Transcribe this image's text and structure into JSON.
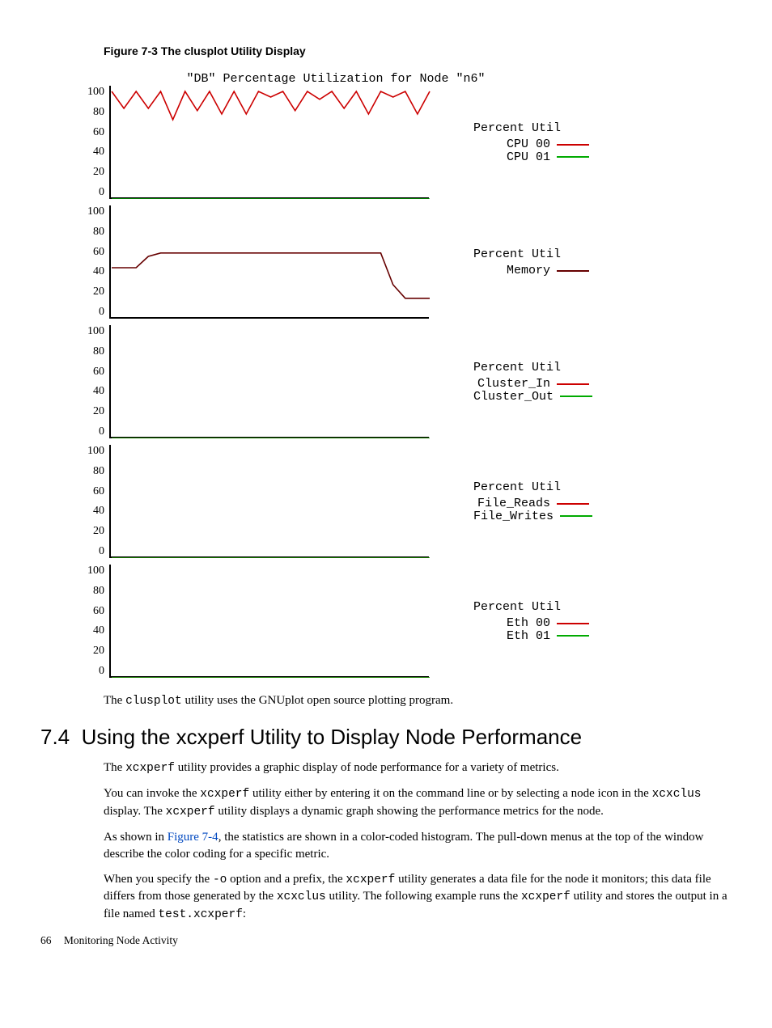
{
  "figure": {
    "caption": "Figure 7-3  The clusplot Utility Display",
    "title": "\"DB\" Percentage Utilization for Node \"n6\""
  },
  "yticks": [
    "100",
    "80",
    "60",
    "40",
    "20",
    "0"
  ],
  "chart_data": [
    {
      "type": "line",
      "title": "Percent Util",
      "ylabel": "",
      "xlabel": "",
      "ylim": [
        0,
        100
      ],
      "series": [
        {
          "name": "CPU 00",
          "color": "#c00",
          "values": [
            95,
            80,
            95,
            80,
            95,
            70,
            95,
            78,
            95,
            75,
            95,
            75,
            95,
            90,
            95,
            78,
            95,
            88,
            95,
            80,
            95,
            75,
            95,
            90,
            95,
            75,
            95
          ]
        },
        {
          "name": "CPU 01",
          "color": "#0a0",
          "values": [
            0,
            0,
            0,
            0,
            0,
            0,
            0,
            0,
            0,
            0,
            0,
            0,
            0,
            0,
            0,
            0,
            0,
            0,
            0,
            0,
            0,
            0,
            0,
            0,
            0,
            0,
            0
          ]
        }
      ]
    },
    {
      "type": "line",
      "title": "Percent Util",
      "ylim": [
        0,
        100
      ],
      "series": [
        {
          "name": "Memory",
          "color": "#600",
          "values": [
            45,
            45,
            45,
            55,
            58,
            58,
            58,
            58,
            58,
            58,
            58,
            58,
            58,
            58,
            58,
            58,
            58,
            58,
            58,
            58,
            58,
            58,
            58,
            30,
            18,
            18,
            18
          ]
        }
      ]
    },
    {
      "type": "line",
      "title": "Percent Util",
      "ylim": [
        0,
        100
      ],
      "series": [
        {
          "name": "Cluster_In",
          "color": "#c00",
          "values": [
            0,
            0,
            0,
            0,
            0,
            0,
            0,
            0,
            0,
            0,
            0,
            0,
            0,
            0,
            0,
            0,
            0,
            0,
            0,
            0,
            0,
            0,
            0,
            0,
            0,
            0,
            0
          ]
        },
        {
          "name": "Cluster_Out",
          "color": "#0a0",
          "values": [
            0,
            0,
            0,
            0,
            0,
            0,
            0,
            0,
            0,
            0,
            0,
            0,
            0,
            0,
            0,
            0,
            0,
            0,
            0,
            0,
            0,
            0,
            0,
            0,
            0,
            0,
            0
          ]
        }
      ]
    },
    {
      "type": "line",
      "title": "Percent Util",
      "ylim": [
        0,
        100
      ],
      "series": [
        {
          "name": "File_Reads",
          "color": "#c00",
          "values": [
            0,
            0,
            0,
            0,
            0,
            0,
            0,
            0,
            0,
            0,
            0,
            0,
            0,
            0,
            0,
            0,
            0,
            0,
            0,
            0,
            0,
            0,
            0,
            0,
            0,
            0,
            0
          ]
        },
        {
          "name": "File_Writes",
          "color": "#0a0",
          "values": [
            0,
            0,
            0,
            0,
            0,
            0,
            0,
            0,
            0,
            0,
            0,
            0,
            0,
            0,
            0,
            0,
            0,
            0,
            0,
            0,
            0,
            0,
            0,
            0,
            0,
            0,
            0
          ]
        }
      ]
    },
    {
      "type": "line",
      "title": "Percent Util",
      "ylim": [
        0,
        100
      ],
      "series": [
        {
          "name": "Eth 00",
          "color": "#c00",
          "values": [
            0,
            0,
            0,
            0,
            0,
            0,
            0,
            0,
            0,
            0,
            0,
            0,
            0,
            0,
            0,
            0,
            0,
            0,
            0,
            0,
            0,
            0,
            0,
            0,
            0,
            0,
            0
          ]
        },
        {
          "name": "Eth 01",
          "color": "#0a0",
          "values": [
            0,
            0,
            0,
            0,
            0,
            0,
            0,
            0,
            0,
            0,
            0,
            0,
            0,
            0,
            0,
            0,
            0,
            0,
            0,
            0,
            0,
            0,
            0,
            0,
            0,
            0,
            0
          ]
        }
      ]
    }
  ],
  "para1_a": "The ",
  "para1_code": "clusplot",
  "para1_b": " utility uses the GNUplot open source plotting program.",
  "section_num": "7.4",
  "section_title": "Using the xcxperf Utility to Display Node Performance",
  "p2_a": "The ",
  "p2_code": "xcxperf",
  "p2_b": " utility provides a graphic display of node performance for a variety of metrics.",
  "p3_a": "You can invoke the ",
  "p3_code1": "xcxperf",
  "p3_b": " utility either by entering it on the command line or by selecting a node icon in the ",
  "p3_code2": "xcxclus",
  "p3_c": " display. The ",
  "p3_code3": "xcxperf",
  "p3_d": " utility displays a dynamic graph showing the performance metrics for the node.",
  "p4_a": "As shown in ",
  "p4_link": "Figure 7-4",
  "p4_b": ", the statistics are shown in a color-coded histogram. The pull-down menus at the top of the window describe the color coding for a specific metric.",
  "p5_a": "When you specify the ",
  "p5_code1": "-o",
  "p5_b": " option and a prefix, the ",
  "p5_code2": "xcxperf",
  "p5_c": " utility generates a data file for the node it monitors; this data file differs from those generated by the ",
  "p5_code3": "xcxclus",
  "p5_d": " utility. The following example runs the ",
  "p5_code4": "xcxperf",
  "p5_e": " utility and stores the output in a file named ",
  "p5_code5": "test.xcxperf",
  "p5_f": ":",
  "footer_page": "66",
  "footer_text": "Monitoring Node Activity"
}
